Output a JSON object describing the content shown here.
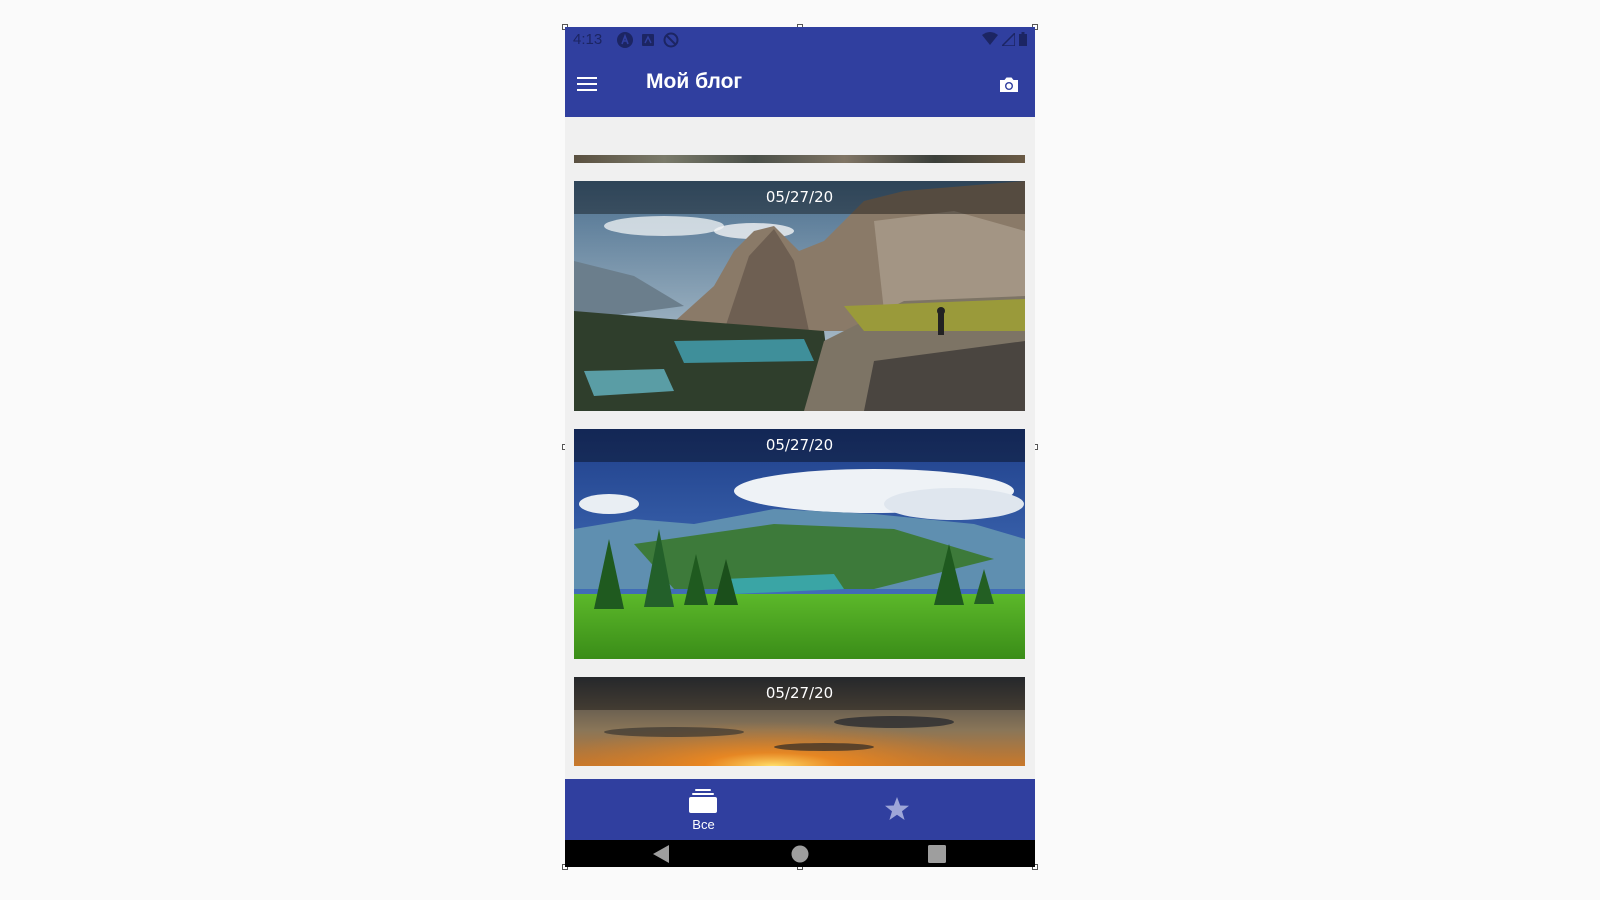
{
  "status_bar": {
    "time": "4:13",
    "left_icons": [
      "notification-a-icon",
      "notification-app-icon",
      "do-not-disturb-icon"
    ],
    "right_icons": [
      "wifi-icon",
      "cell-signal-icon",
      "battery-icon"
    ]
  },
  "toolbar": {
    "title": "Мой блог",
    "menu_icon": "hamburger-menu-icon",
    "action_icon": "camera-icon"
  },
  "posts": [
    {
      "date": "05/27/20",
      "image": "mountain-lake-photographer"
    },
    {
      "date": "05/27/20",
      "image": "green-meadow-valley"
    },
    {
      "date": "05/27/20",
      "image": "sunset-clouds"
    }
  ],
  "bottom_nav": {
    "items": [
      {
        "label": "Все",
        "icon": "stack-cards-icon",
        "selected": true
      },
      {
        "label": "",
        "icon": "star-icon",
        "selected": false
      }
    ]
  },
  "system_nav": [
    "back-icon",
    "home-icon",
    "recents-icon"
  ],
  "colors": {
    "primary": "#303f9f",
    "background": "#f0f0f0",
    "system_bar": "#000000"
  }
}
